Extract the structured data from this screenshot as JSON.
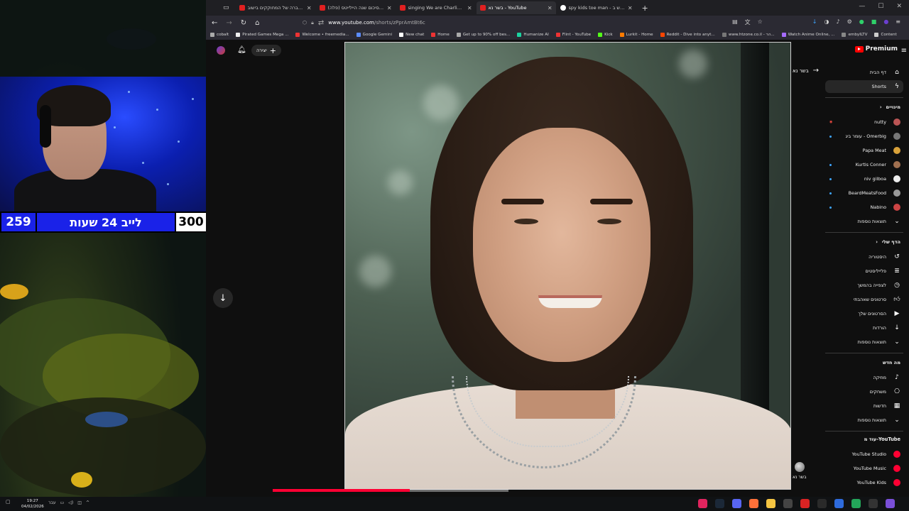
{
  "stream": {
    "counter_left": "259",
    "counter_label": "לייב 24 שעות",
    "counter_right": "300"
  },
  "browser": {
    "tabs": [
      {
        "label": "העברה של המחוקקים בישוב",
        "active": false,
        "favicon": "youtube"
      },
      {
        "label": "(פלה) 2025 סיכום שנה היילייטס",
        "active": false,
        "favicon": "youtube"
      },
      {
        "label": "singing We are Charlie Kirk - Yo",
        "active": false,
        "favicon": "youtube"
      },
      {
        "label": "בשר נא - YouTube",
        "active": true,
        "favicon": "youtube"
      },
      {
        "label": "spy kids toe man - חיפוש ב-Go",
        "active": false,
        "favicon": "google"
      }
    ],
    "url_host": "www.youtube.com",
    "url_path": "/shorts/zPprAmtBt6c",
    "bookmarks": [
      "cobalt",
      "Pirated Games Mega ...",
      "Welcome • freemedia...",
      "Google Gemini",
      "New chat",
      "Home",
      "Get up to 90% off bes...",
      "Humanize AI",
      "Flint - YouTube",
      "Kick",
      "Lurkit - Home",
      "Reddit - Dive into anyt...",
      "www.htzone.co.il - הר...",
      "Watch Anime Online, ...",
      "embyILTV",
      "Content"
    ]
  },
  "youtube": {
    "create_label": "יצירה",
    "back_label": "בשר נא",
    "channel_label": "בשר נא",
    "logo_text": "Premium",
    "progress": 0.58,
    "sidebar": {
      "main": [
        {
          "label": "דף הבית",
          "icon": "home-icon",
          "active": false
        },
        {
          "label": "Shorts",
          "icon": "shorts-icon",
          "active": true
        }
      ],
      "subs_heading": "מינויים",
      "subs": [
        {
          "label": "nutty",
          "marker": "live"
        },
        {
          "label": "עומר ביג - Omerbig",
          "marker": "dot"
        },
        {
          "label": "Papa Meat",
          "marker": "none"
        },
        {
          "label": "Kurtis Conner",
          "marker": "dot"
        },
        {
          "label": "niv gilboa",
          "marker": "dot"
        },
        {
          "label": "BeardMeatsFood",
          "marker": "dot"
        },
        {
          "label": "Nabino",
          "marker": "dot"
        },
        {
          "label": "תוצאות נוספות",
          "marker": "chevron"
        }
      ],
      "you_heading": "הדף שלי",
      "you": [
        {
          "label": "היסטוריה",
          "icon": "history-icon"
        },
        {
          "label": "פלייליסטים",
          "icon": "playlist-icon"
        },
        {
          "label": "לצפייה בהמשך",
          "icon": "clock-icon"
        },
        {
          "label": "סרטונים שאהבתי",
          "icon": "like-icon"
        },
        {
          "label": "הסרטונים שלך",
          "icon": "video-icon"
        },
        {
          "label": "הורדות",
          "icon": "download-icon"
        },
        {
          "label": "תוצאות נוספות",
          "icon": "chevron-down-icon"
        }
      ],
      "explore_heading": "מה חדש",
      "explore": [
        {
          "label": "מוזיקה",
          "icon": "music-icon"
        },
        {
          "label": "משחקים",
          "icon": "gaming-icon"
        },
        {
          "label": "חדשות",
          "icon": "news-icon"
        },
        {
          "label": "תוצאות נוספות",
          "icon": "chevron-down-icon"
        }
      ],
      "more_heading": "עוד מ-YouTube",
      "more": [
        {
          "label": "YouTube Studio"
        },
        {
          "label": "YouTube Music"
        },
        {
          "label": "YouTube Kids"
        }
      ]
    }
  },
  "taskbar": {
    "time": "19:27",
    "date": "04/02/2026",
    "lang": "עבר"
  }
}
